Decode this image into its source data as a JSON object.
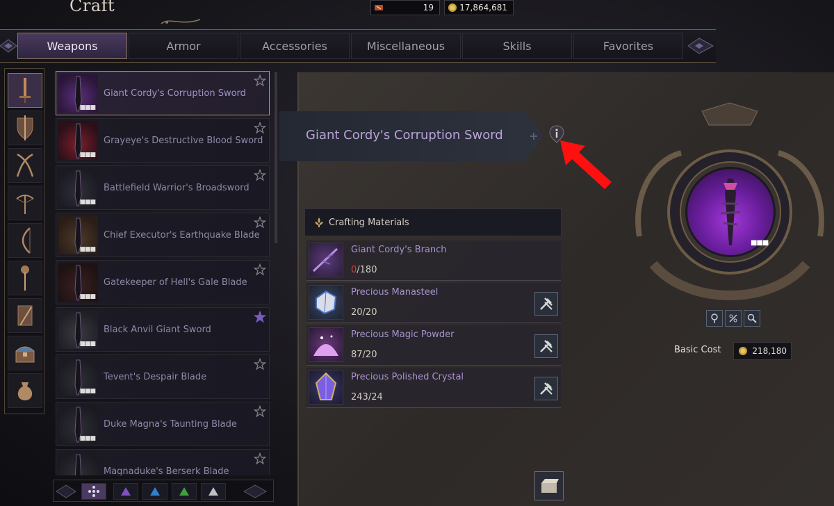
{
  "header": {
    "title": "Craft",
    "currency1": {
      "icon": "crafting-ticket-icon",
      "value": "19"
    },
    "currency2": {
      "icon": "gold-coin-icon",
      "value": "17,864,681"
    }
  },
  "tabs": [
    {
      "label": "Weapons",
      "active": true
    },
    {
      "label": "Armor",
      "active": false
    },
    {
      "label": "Accessories",
      "active": false
    },
    {
      "label": "Miscellaneous",
      "active": false
    },
    {
      "label": "Skills",
      "active": false
    },
    {
      "label": "Favorites",
      "active": false
    }
  ],
  "categories": [
    {
      "icon": "greatsword-icon",
      "active": true
    },
    {
      "icon": "sword-shield-icon",
      "active": false
    },
    {
      "icon": "dual-blades-icon",
      "active": false
    },
    {
      "icon": "crossbow-icon",
      "active": false
    },
    {
      "icon": "longbow-icon",
      "active": false
    },
    {
      "icon": "staff-icon",
      "active": false
    },
    {
      "icon": "wand-tome-icon",
      "active": false
    },
    {
      "icon": "chest-icon",
      "active": false
    },
    {
      "icon": "pouch-icon",
      "active": false
    }
  ],
  "items": [
    {
      "name": "Giant Cordy's Corruption Sword",
      "selected": true,
      "favorite": false
    },
    {
      "name": "Grayeye's Destructive Blood Sword",
      "selected": false,
      "favorite": false
    },
    {
      "name": "Battlefield Warrior's Broadsword",
      "selected": false,
      "favorite": false
    },
    {
      "name": "Chief Executor's Earthquake Blade",
      "selected": false,
      "favorite": false
    },
    {
      "name": "Gatekeeper of Hell's Gale Blade",
      "selected": false,
      "favorite": false
    },
    {
      "name": "Black Anvil Giant Sword",
      "selected": false,
      "favorite": true
    },
    {
      "name": "Tevent's Despair Blade",
      "selected": false,
      "favorite": false
    },
    {
      "name": "Duke Magna's Taunting Blade",
      "selected": false,
      "favorite": false
    },
    {
      "name": "Magnaduke's Berserk Blade",
      "selected": false,
      "favorite": false
    }
  ],
  "detail": {
    "title": "Giant Cordy's Corruption Sword",
    "materials_header": "Crafting Materials",
    "materials": [
      {
        "name": "Giant Cordy's Branch",
        "have": "0",
        "need": "/180",
        "insufficient": true,
        "craftable": false
      },
      {
        "name": "Precious Manasteel",
        "have": "20",
        "need": "/20",
        "insufficient": false,
        "craftable": true
      },
      {
        "name": "Precious Magic Powder",
        "have": "87",
        "need": "/20",
        "insufficient": false,
        "craftable": true
      },
      {
        "name": "Precious Polished Crystal",
        "have": "243",
        "need": "/24",
        "insufficient": false,
        "craftable": true
      }
    ],
    "cost_label": "Basic Cost",
    "cost_value": "218,180"
  },
  "colors": {
    "accent_purple": "#4a3a5e",
    "gold_border": "#b39c72",
    "insufficient_red": "#d6403c",
    "annotation_red": "#ff1010"
  }
}
